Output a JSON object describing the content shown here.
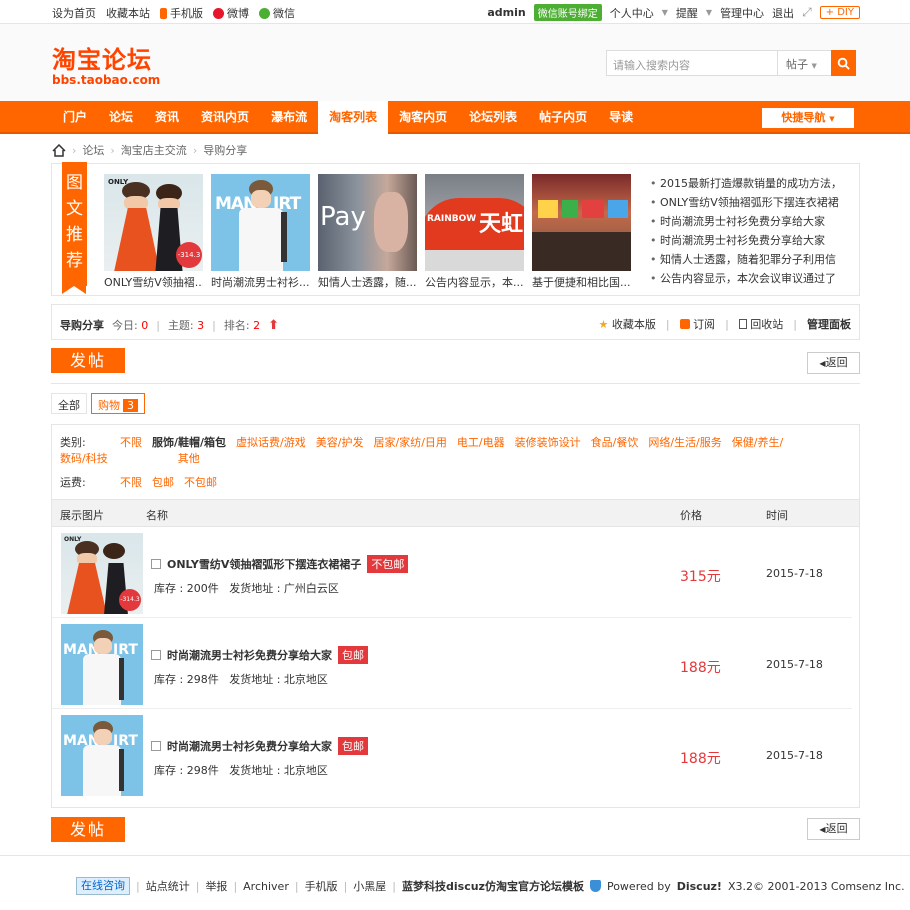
{
  "topbar": {
    "left": [
      "设为首页",
      "收藏本站"
    ],
    "mobile": "手机版",
    "weibo": "微博",
    "weixin": "微信",
    "user": "admin",
    "wx_bind": "微信账号绑定",
    "menu": [
      "个人中心",
      "提醒",
      "管理中心",
      "退出"
    ],
    "diy": "+ DIY"
  },
  "logo": {
    "cn": "淘宝论坛",
    "url": "bbs.taobao.com"
  },
  "search": {
    "placeholder": "请输入搜索内容",
    "type": "帖子"
  },
  "nav": {
    "items": [
      "门户",
      "论坛",
      "资讯",
      "资讯内页",
      "瀑布流",
      "淘客列表",
      "淘客内页",
      "论坛列表",
      "帖子内页",
      "导读"
    ],
    "active": "淘客列表",
    "quick": "快捷导航"
  },
  "breadcrumb": [
    "论坛",
    "淘宝店主交流",
    "导购分享"
  ],
  "recommend": {
    "tag": [
      "图",
      "文",
      "推",
      "荐"
    ],
    "pics": [
      {
        "caption": "ONLY雪纺V领抽褶..."
      },
      {
        "caption": "时尚潮流男士衬衫..."
      },
      {
        "caption": "知情人士透露，随..."
      },
      {
        "caption": "公告内容显示，本..."
      },
      {
        "caption": "基于便捷和相比国..."
      }
    ],
    "list": [
      "2015最新打造爆款销量的成功方法，",
      "ONLY雪纺V领抽褶弧形下摆连衣裙裙",
      "时尚潮流男士衬衫免费分享给大家",
      "时尚潮流男士衬衫免费分享给大家",
      "知情人士透露，随着犯罪分子利用信",
      "公告内容显示，本次会议审议通过了"
    ]
  },
  "forum": {
    "name": "导购分享",
    "today_label": "今日:",
    "today": "0",
    "topics_label": "主题:",
    "topics": "3",
    "rank_label": "排名:",
    "rank": "2",
    "actions": [
      "收藏本版",
      "订阅",
      "回收站",
      "管理面板"
    ]
  },
  "buttons": {
    "post": "发帖",
    "back": "返回"
  },
  "tabs": {
    "all": "全部",
    "shop": "购物",
    "shop_count": "3"
  },
  "filter": {
    "cat_label": "类别:",
    "cats": [
      "不限",
      "服饰/鞋帽/箱包",
      "虚拟话费/游戏",
      "美容/护发",
      "居家/家纺/日用",
      "电工/电器",
      "装修装饰设计",
      "食品/餐饮",
      "网络/生活/服务",
      "保健/养生/",
      "数码/科技",
      "其他"
    ],
    "cat_selected": "服饰/鞋帽/箱包",
    "ship_label": "运费:",
    "ship": [
      "不限",
      "包邮",
      "不包邮"
    ]
  },
  "table": {
    "headers": [
      "展示图片",
      "名称",
      "价格",
      "时间"
    ],
    "rows": [
      {
        "title": "ONLY雪纺V领抽褶弧形下摆连衣裙裙子",
        "tag": "不包邮",
        "stock": "库存 : 200件",
        "addr": "发货地址 : 广州白云区",
        "price": "315元",
        "date": "2015-7-18"
      },
      {
        "title": "时尚潮流男士衬衫免费分享给大家",
        "tag": "包邮",
        "stock": "库存 : 298件",
        "addr": "发货地址 : 北京地区",
        "price": "188元",
        "date": "2015-7-18"
      },
      {
        "title": "时尚潮流男士衬衫免费分享给大家",
        "tag": "包邮",
        "stock": "库存 : 298件",
        "addr": "发货地址 : 北京地区",
        "price": "188元",
        "date": "2015-7-18"
      }
    ]
  },
  "footer": {
    "online": "在线咨询",
    "links": [
      "站点统计",
      "举报",
      "Archiver",
      "手机版",
      "小黑屋"
    ],
    "brand": "蓝梦科技discuz仿淘宝官方论坛模板",
    "powered": "Powered by",
    "discuz": "Discuz!",
    "copy": "X3.2© 2001-2013 Comsenz Inc."
  },
  "colors": {
    "accent": "#ff6600",
    "price": "#e4393c"
  }
}
